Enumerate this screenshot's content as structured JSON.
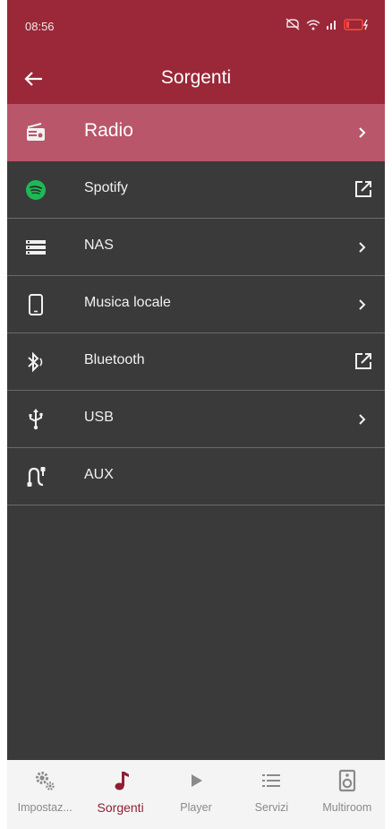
{
  "status_bar": {
    "time": "08:56"
  },
  "app_bar": {
    "title": "Sorgenti"
  },
  "sources": [
    {
      "label": "Radio",
      "icon": "radio-icon",
      "action": "chevron",
      "selected": true
    },
    {
      "label": "Spotify",
      "icon": "spotify-icon",
      "action": "external"
    },
    {
      "label": "NAS",
      "icon": "nas-icon",
      "action": "chevron"
    },
    {
      "label": "Musica locale",
      "icon": "smartphone-icon",
      "action": "chevron"
    },
    {
      "label": "Bluetooth",
      "icon": "bluetooth-icon",
      "action": "external"
    },
    {
      "label": "USB",
      "icon": "usb-icon",
      "action": "chevron"
    },
    {
      "label": "AUX",
      "icon": "aux-icon",
      "action": "none"
    }
  ],
  "bottom_nav": [
    {
      "label": "Impostaz...",
      "icon": "settings-gears-icon"
    },
    {
      "label": "Sorgenti",
      "icon": "music-note-icon",
      "active": true
    },
    {
      "label": "Player",
      "icon": "play-icon"
    },
    {
      "label": "Servizi",
      "icon": "list-icon"
    },
    {
      "label": "Multiroom",
      "icon": "speaker-icon"
    }
  ],
  "colors": {
    "header": "#9a2838",
    "selected_row": "#b9566a",
    "list_background": "#3a3a3a",
    "nav_active": "#8e2034",
    "spotify_green": "#1db954"
  }
}
